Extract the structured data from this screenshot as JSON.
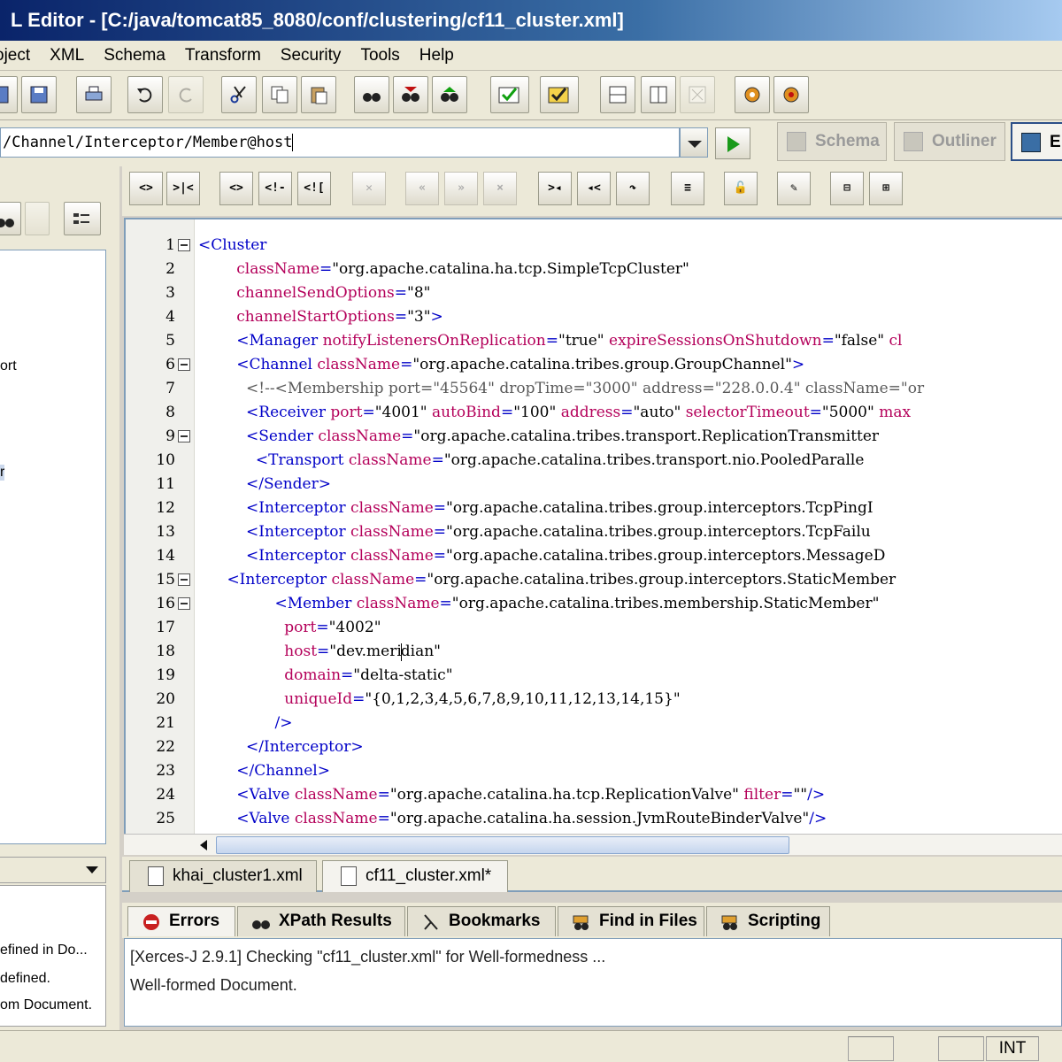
{
  "window": {
    "title": "L Editor - [C:/java/tomcat85_8080/conf/clustering/cf11_cluster.xml]"
  },
  "menu": [
    {
      "label": "oject"
    },
    {
      "label": "XML"
    },
    {
      "label": "Schema"
    },
    {
      "label": "Transform"
    },
    {
      "label": "Security"
    },
    {
      "label": "Tools"
    },
    {
      "label": "Help"
    }
  ],
  "xpath": {
    "value": "/Channel/Interceptor/Member@host"
  },
  "modes": {
    "schema": "Schema",
    "outliner": "Outliner",
    "editor": "E"
  },
  "left": {
    "tree_items": [
      "ort",
      "r"
    ],
    "messages": [
      "efined in Do...",
      "defined.",
      "om Document."
    ]
  },
  "editor_toolbar": {
    "buttons": [
      "<>",
      "<!-",
      "<!["
    ]
  },
  "editor": {
    "lines": [
      {
        "n": "1",
        "indent": "",
        "parts": [
          [
            "tag",
            "<Cluster"
          ]
        ]
      },
      {
        "n": "2",
        "indent": "        ",
        "parts": [
          [
            "attr",
            "className"
          ],
          [
            "tag",
            "="
          ],
          [
            "val",
            "\"org.apache.catalina.ha.tcp.SimpleTcpCluster\""
          ]
        ]
      },
      {
        "n": "3",
        "indent": "        ",
        "parts": [
          [
            "attr",
            "channelSendOptions"
          ],
          [
            "tag",
            "="
          ],
          [
            "val",
            "\"8\""
          ]
        ]
      },
      {
        "n": "4",
        "indent": "        ",
        "parts": [
          [
            "attr",
            "channelStartOptions"
          ],
          [
            "tag",
            "="
          ],
          [
            "val",
            "\"3\""
          ],
          [
            "tag",
            ">"
          ]
        ]
      },
      {
        "n": "5",
        "indent": "        ",
        "parts": [
          [
            "tag",
            "<Manager "
          ],
          [
            "attr",
            "notifyListenersOnReplication"
          ],
          [
            "tag",
            "="
          ],
          [
            "val",
            "\"true\" "
          ],
          [
            "attr",
            "expireSessionsOnShutdown"
          ],
          [
            "tag",
            "="
          ],
          [
            "val",
            "\"false\" "
          ],
          [
            "attr",
            "cl"
          ]
        ]
      },
      {
        "n": "6",
        "indent": "        ",
        "parts": [
          [
            "tag",
            "<Channel "
          ],
          [
            "attr",
            "className"
          ],
          [
            "tag",
            "="
          ],
          [
            "val",
            "\"org.apache.catalina.tribes.group.GroupChannel\""
          ],
          [
            "tag",
            ">"
          ]
        ]
      },
      {
        "n": "7",
        "indent": "          ",
        "parts": [
          [
            "comment",
            "<!--<Membership port=\"45564\" dropTime=\"3000\" address=\"228.0.0.4\" className=\"or"
          ]
        ]
      },
      {
        "n": "8",
        "indent": "          ",
        "parts": [
          [
            "tag",
            "<Receiver "
          ],
          [
            "attr",
            "port"
          ],
          [
            "tag",
            "="
          ],
          [
            "val",
            "\"4001\" "
          ],
          [
            "attr",
            "autoBind"
          ],
          [
            "tag",
            "="
          ],
          [
            "val",
            "\"100\" "
          ],
          [
            "attr",
            "address"
          ],
          [
            "tag",
            "="
          ],
          [
            "val",
            "\"auto\" "
          ],
          [
            "attr",
            "selectorTimeout"
          ],
          [
            "tag",
            "="
          ],
          [
            "val",
            "\"5000\" "
          ],
          [
            "attr",
            "max"
          ]
        ]
      },
      {
        "n": "9",
        "indent": "          ",
        "parts": [
          [
            "tag",
            "<Sender "
          ],
          [
            "attr",
            "className"
          ],
          [
            "tag",
            "="
          ],
          [
            "val",
            "\"org.apache.catalina.tribes.transport.ReplicationTransmitter"
          ]
        ]
      },
      {
        "n": "10",
        "indent": "            ",
        "parts": [
          [
            "tag",
            "<Transport "
          ],
          [
            "attr",
            "className"
          ],
          [
            "tag",
            "="
          ],
          [
            "val",
            "\"org.apache.catalina.tribes.transport.nio.PooledParalle"
          ]
        ]
      },
      {
        "n": "11",
        "indent": "          ",
        "parts": [
          [
            "tag",
            "</Sender>"
          ]
        ]
      },
      {
        "n": "12",
        "indent": "          ",
        "parts": [
          [
            "tag",
            "<Interceptor "
          ],
          [
            "attr",
            "className"
          ],
          [
            "tag",
            "="
          ],
          [
            "val",
            "\"org.apache.catalina.tribes.group.interceptors.TcpPingI"
          ]
        ]
      },
      {
        "n": "13",
        "indent": "          ",
        "parts": [
          [
            "tag",
            "<Interceptor "
          ],
          [
            "attr",
            "className"
          ],
          [
            "tag",
            "="
          ],
          [
            "val",
            "\"org.apache.catalina.tribes.group.interceptors.TcpFailu"
          ]
        ]
      },
      {
        "n": "14",
        "indent": "          ",
        "parts": [
          [
            "tag",
            "<Interceptor "
          ],
          [
            "attr",
            "className"
          ],
          [
            "tag",
            "="
          ],
          [
            "val",
            "\"org.apache.catalina.tribes.group.interceptors.MessageD"
          ]
        ]
      },
      {
        "n": "15",
        "indent": "      ",
        "parts": [
          [
            "tag",
            "<Interceptor "
          ],
          [
            "attr",
            "className"
          ],
          [
            "tag",
            "="
          ],
          [
            "val",
            "\"org.apache.catalina.tribes.group.interceptors.StaticMember"
          ]
        ]
      },
      {
        "n": "16",
        "indent": "                ",
        "parts": [
          [
            "tag",
            "<Member "
          ],
          [
            "attr",
            "className"
          ],
          [
            "tag",
            "="
          ],
          [
            "val",
            "\"org.apache.catalina.tribes.membership.StaticMember\""
          ]
        ]
      },
      {
        "n": "17",
        "indent": "                  ",
        "parts": [
          [
            "attr",
            "port"
          ],
          [
            "tag",
            "="
          ],
          [
            "val",
            "\"4002\""
          ]
        ]
      },
      {
        "n": "18",
        "indent": "                  ",
        "parts": [
          [
            "attr",
            "host"
          ],
          [
            "tag",
            "="
          ],
          [
            "val",
            "\"dev.meri"
          ],
          [
            "caret",
            ""
          ],
          [
            "val",
            "dian\""
          ]
        ]
      },
      {
        "n": "19",
        "indent": "                  ",
        "parts": [
          [
            "attr",
            "domain"
          ],
          [
            "tag",
            "="
          ],
          [
            "val",
            "\"delta-static\""
          ]
        ]
      },
      {
        "n": "20",
        "indent": "                  ",
        "parts": [
          [
            "attr",
            "uniqueId"
          ],
          [
            "tag",
            "="
          ],
          [
            "val",
            "\"{0,1,2,3,4,5,6,7,8,9,10,11,12,13,14,15}\""
          ]
        ]
      },
      {
        "n": "21",
        "indent": "                ",
        "parts": [
          [
            "tag",
            "/>"
          ]
        ]
      },
      {
        "n": "22",
        "indent": "          ",
        "parts": [
          [
            "tag",
            "</Interceptor>"
          ]
        ]
      },
      {
        "n": "23",
        "indent": "        ",
        "parts": [
          [
            "tag",
            "</Channel>"
          ]
        ]
      },
      {
        "n": "24",
        "indent": "        ",
        "parts": [
          [
            "tag",
            "<Valve "
          ],
          [
            "attr",
            "className"
          ],
          [
            "tag",
            "="
          ],
          [
            "val",
            "\"org.apache.catalina.ha.tcp.ReplicationValve\" "
          ],
          [
            "attr",
            "filter"
          ],
          [
            "tag",
            "="
          ],
          [
            "val",
            "\"\""
          ],
          [
            "tag",
            "/>"
          ]
        ]
      },
      {
        "n": "25",
        "indent": "        ",
        "parts": [
          [
            "tag",
            "<Valve "
          ],
          [
            "attr",
            "className"
          ],
          [
            "tag",
            "="
          ],
          [
            "val",
            "\"org.apache.catalina.ha.session.JvmRouteBinderValve\""
          ],
          [
            "tag",
            "/>"
          ]
        ]
      }
    ],
    "folds": [
      "1",
      "6",
      "9",
      "15",
      "16"
    ]
  },
  "file_tabs": [
    "khai_cluster1.xml",
    "cf11_cluster.xml*"
  ],
  "bottom_tabs": [
    "Errors",
    "XPath Results",
    "Bookmarks",
    "Find in Files",
    "Scripting"
  ],
  "output": [
    "[Xerces-J 2.9.1] Checking \"cf11_cluster.xml\" for Well-formedness ...",
    "Well-formed Document."
  ],
  "status": {
    "mode": "INT"
  },
  "colors": {
    "tag": "#0000c8",
    "attribute": "#b4005a",
    "title_bar": "#0a246a"
  }
}
